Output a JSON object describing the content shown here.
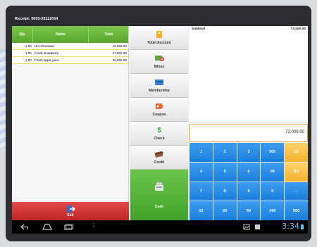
{
  "receipt_title": "Receipt: 0003-29112014",
  "order": {
    "headers": {
      "qty": "Qty",
      "name": "Name",
      "total": "Total"
    },
    "rows": [
      {
        "qty": "1.00",
        "name": "Hot chocolate",
        "total": "16,000.00"
      },
      {
        "qty": "1.00",
        "name": "Fresh strawberry",
        "total": "27,000.00"
      },
      {
        "qty": "1.00",
        "name": "Fresh apple juice",
        "total": "29,000.00"
      }
    ]
  },
  "functions": {
    "total_discount": "Total discount",
    "minus": "Minus",
    "membership": "Membership",
    "coupon": "Coupon",
    "check": "Check",
    "credit": "Credit",
    "cash": "Cash",
    "exit": "Exit"
  },
  "summary": {
    "subtotal_label": "Subtotal",
    "subtotal_value": "72,000.00",
    "amount": "72,000.00"
  },
  "keypad": [
    [
      "1",
      "2",
      "3",
      "000",
      "CE"
    ],
    [
      "4",
      "5",
      "6",
      "00",
      "BS"
    ],
    [
      "7",
      "8",
      "9",
      "0",
      "."
    ],
    [
      "10",
      "20",
      "50",
      "100",
      "500"
    ]
  ],
  "status": {
    "clock": "3:34"
  },
  "colors": {
    "green": "#57a82d",
    "red": "#cc2b2b",
    "blue": "#1a7fdc",
    "orange": "#f4b32e"
  }
}
